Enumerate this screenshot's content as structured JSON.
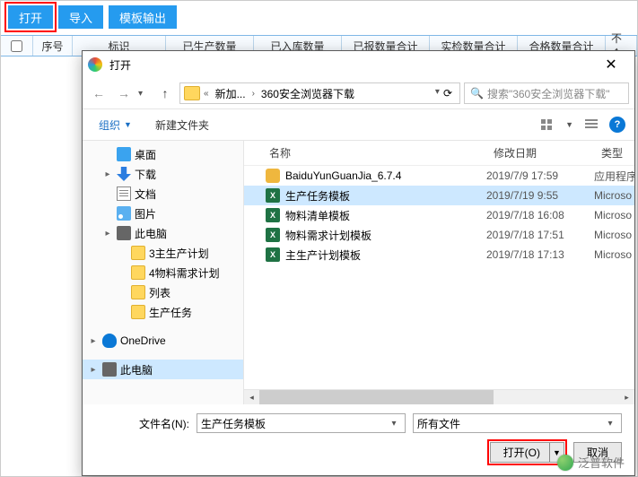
{
  "toolbar": {
    "open": "打开",
    "import": "导入",
    "template": "模板输出"
  },
  "columns": {
    "chk": "",
    "seq": "序号",
    "mark": "标识",
    "q1": "已生产数量",
    "q2": "已入库数量",
    "q3": "已报数量合计",
    "q4": "实检数量合计",
    "q5": "合格数量合计",
    "q6": "不合"
  },
  "dialog": {
    "title": "打开",
    "nav": {
      "up_tooltip": "↑",
      "segments": [
        "新加...",
        "360安全浏览器下载"
      ]
    },
    "search_placeholder": "搜索\"360安全浏览器下载\"",
    "toolbar": {
      "organize": "组织",
      "newfolder": "新建文件夹"
    },
    "tree": [
      {
        "exp": "",
        "icon": "ico-desktop",
        "indent": 1,
        "label": "桌面"
      },
      {
        "exp": "▸",
        "icon": "ico-download",
        "indent": 1,
        "label": "下载"
      },
      {
        "exp": "",
        "icon": "ico-doc",
        "indent": 1,
        "label": "文档"
      },
      {
        "exp": "",
        "icon": "ico-pic",
        "indent": 1,
        "label": "图片"
      },
      {
        "exp": "▸",
        "icon": "ico-pc",
        "indent": 1,
        "label": "此电脑"
      },
      {
        "exp": "",
        "icon": "ico-folder",
        "indent": 2,
        "label": "3主生产计划"
      },
      {
        "exp": "",
        "icon": "ico-folder",
        "indent": 2,
        "label": "4物料需求计划"
      },
      {
        "exp": "",
        "icon": "ico-folder",
        "indent": 2,
        "label": "列表"
      },
      {
        "exp": "",
        "icon": "ico-folder",
        "indent": 2,
        "label": "生产任务"
      },
      {
        "exp": "",
        "spacer": true
      },
      {
        "exp": "▸",
        "icon": "ico-onedrive",
        "indent": 0,
        "label": "OneDrive"
      },
      {
        "exp": "",
        "spacer": true
      },
      {
        "exp": "▸",
        "icon": "ico-pc",
        "indent": 0,
        "label": "此电脑",
        "selected": true
      }
    ],
    "fileHeader": {
      "name": "名称",
      "date": "修改日期",
      "type": "类型"
    },
    "files": [
      {
        "icon": "ico-exe",
        "name": "BaiduYunGuanJia_6.7.4",
        "date": "2019/7/9 17:59",
        "type": "应用程序"
      },
      {
        "icon": "ico-excel",
        "name": "生产任务模板",
        "date": "2019/7/19 9:55",
        "type": "Microso",
        "selected": true
      },
      {
        "icon": "ico-excel",
        "name": "物料清单模板",
        "date": "2019/7/18 16:08",
        "type": "Microso"
      },
      {
        "icon": "ico-excel",
        "name": "物料需求计划模板",
        "date": "2019/7/18 17:51",
        "type": "Microso"
      },
      {
        "icon": "ico-excel",
        "name": "主生产计划模板",
        "date": "2019/7/18 17:13",
        "type": "Microso"
      }
    ],
    "filenameLabel": "文件名(N):",
    "filenameValue": "生产任务模板",
    "filterValue": "所有文件",
    "openBtn": "打开(O)",
    "cancelBtn": "取消"
  },
  "watermark": "泛普软件"
}
